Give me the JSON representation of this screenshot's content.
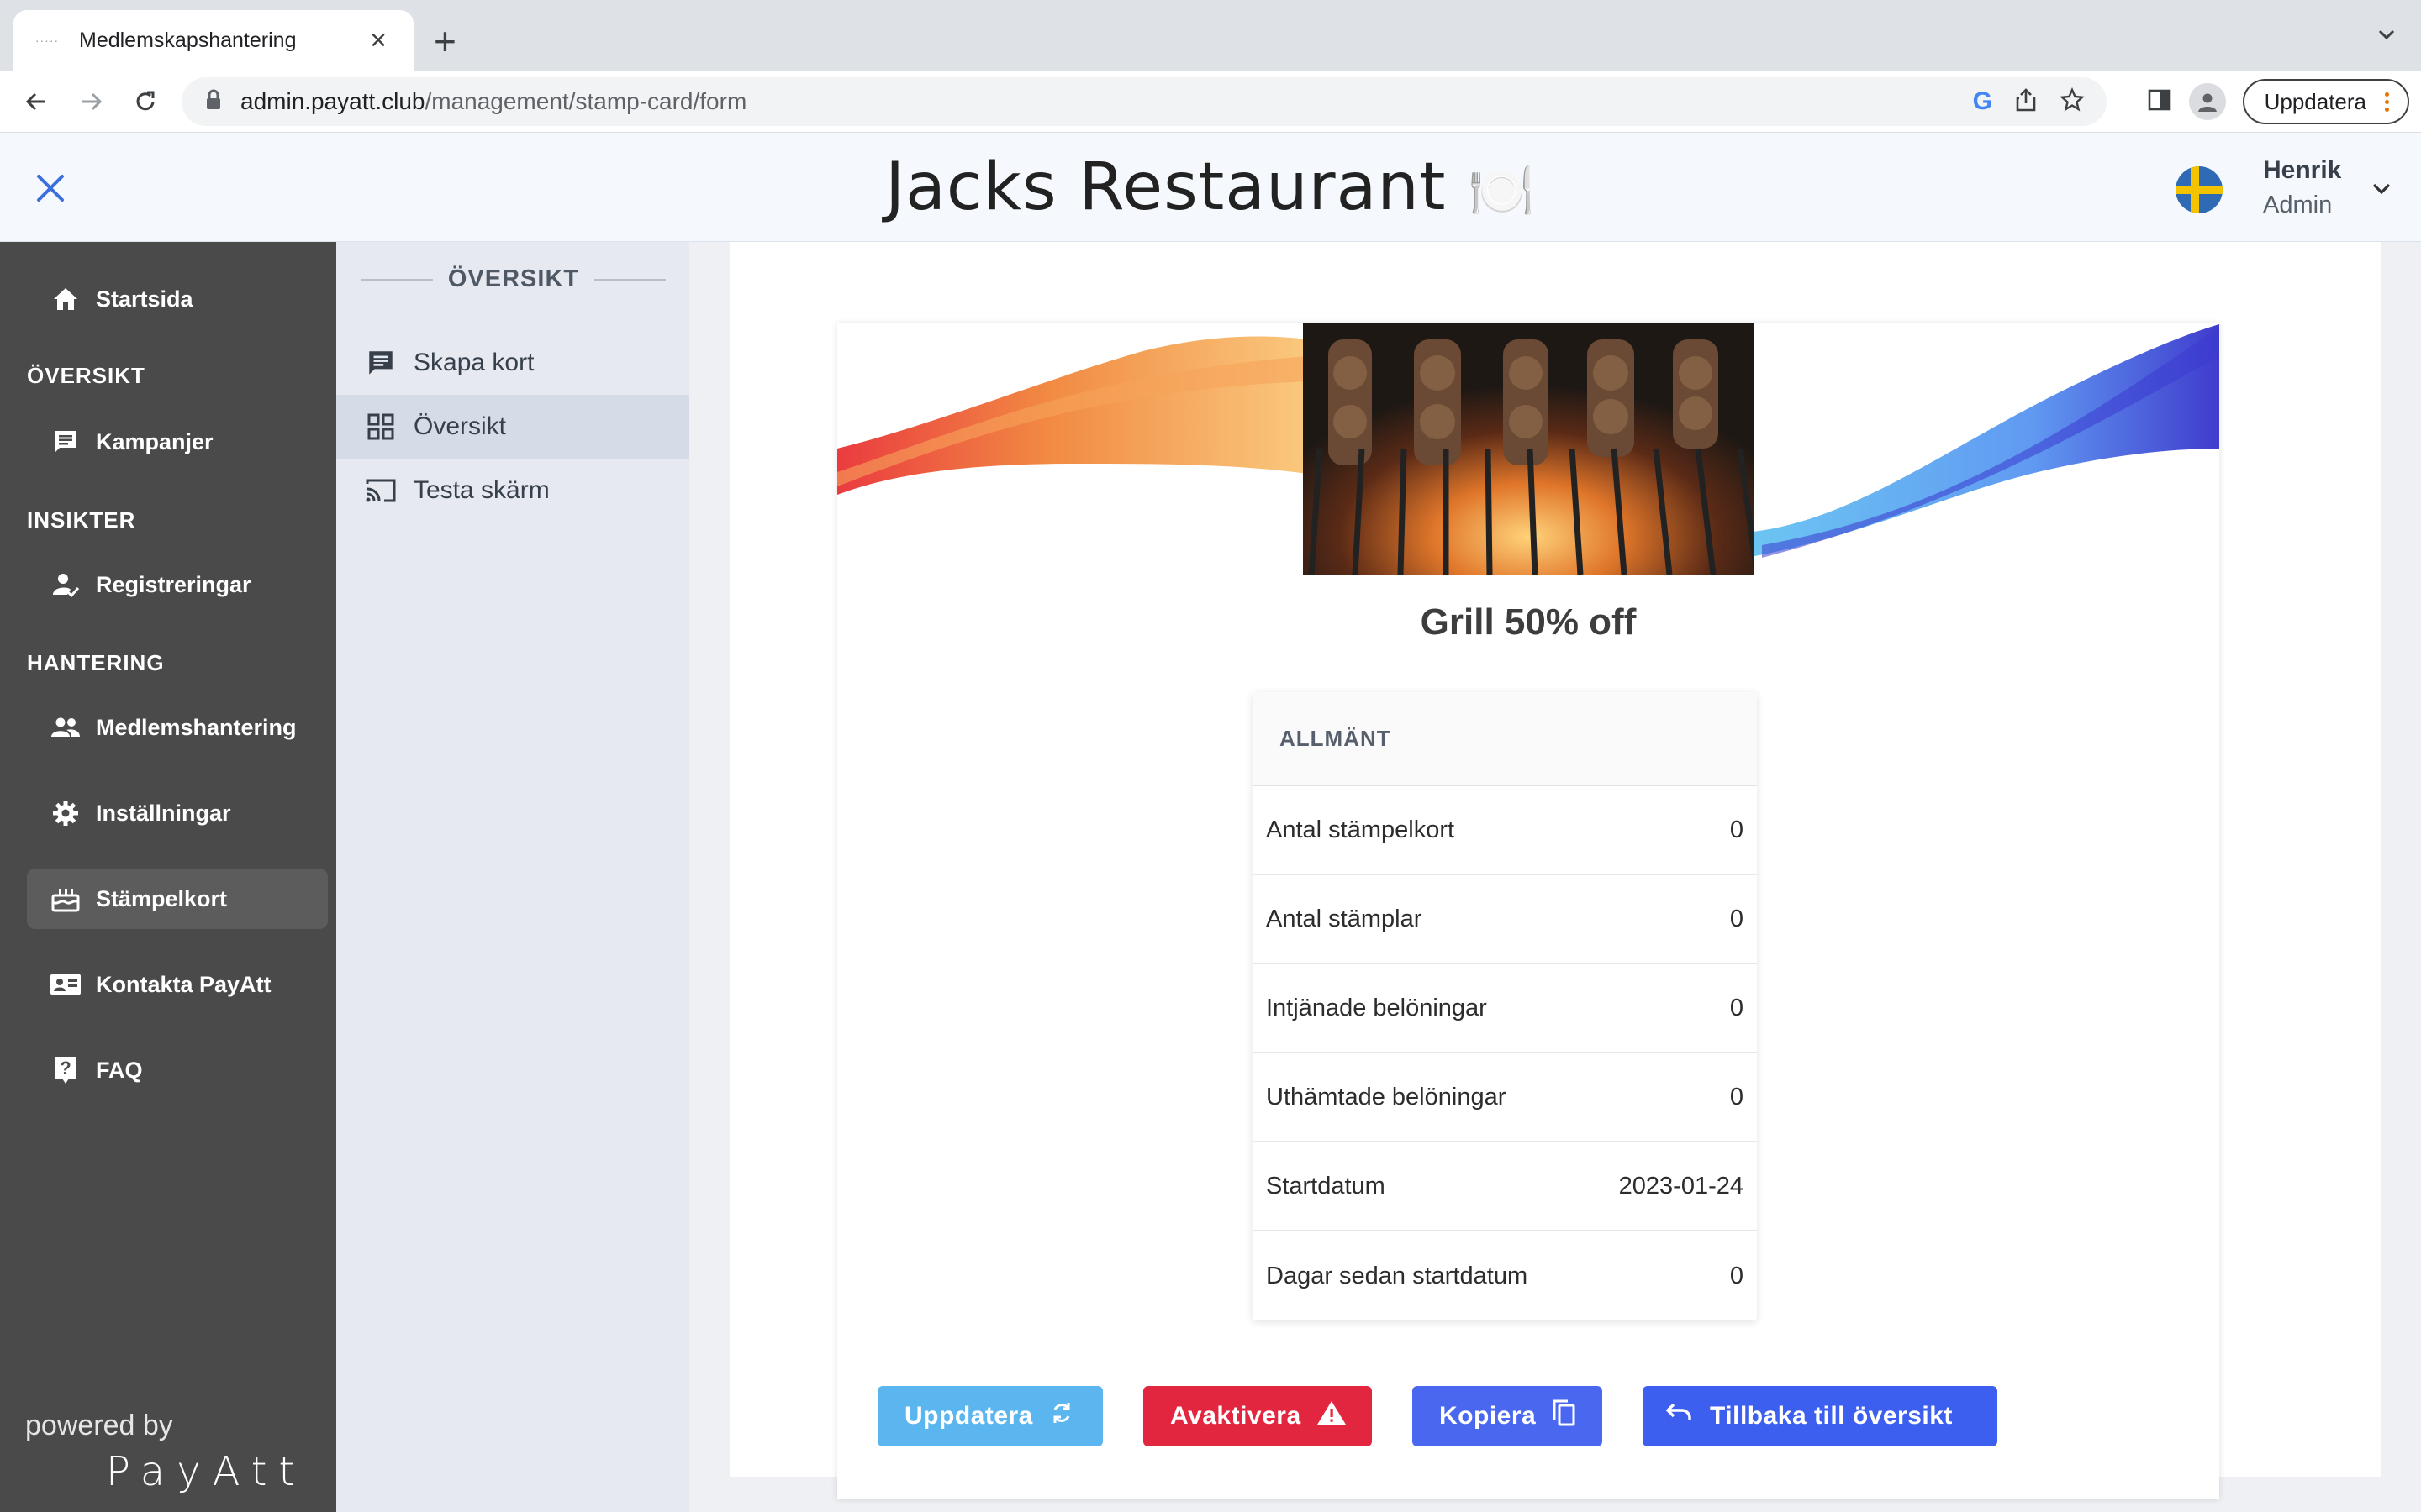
{
  "browser": {
    "tab_title": "Medlemskapshantering",
    "url_host": "admin.payatt.club",
    "url_path": "/management/stamp-card/form",
    "update_label": "Uppdatera"
  },
  "header": {
    "title": "Jacks Restaurant",
    "title_emoji": "🍽️",
    "user_name": "Henrik",
    "user_role": "Admin"
  },
  "sidebar": {
    "items": [
      {
        "label": "Startsida",
        "icon": "home-icon"
      },
      {
        "section": "ÖVERSIKT"
      },
      {
        "label": "Kampanjer",
        "icon": "message-icon"
      },
      {
        "section": "INSIKTER"
      },
      {
        "label": "Registreringar",
        "icon": "person-check-icon"
      },
      {
        "section": "HANTERING"
      },
      {
        "label": "Medlemshantering",
        "icon": "group-icon"
      },
      {
        "label": "Inställningar",
        "icon": "gear-icon"
      },
      {
        "label": "Stämpelkort",
        "icon": "cake-icon",
        "active": true
      },
      {
        "label": "Kontakta PayAtt",
        "icon": "contact-card-icon"
      },
      {
        "label": "FAQ",
        "icon": "help-icon"
      }
    ],
    "powered_by": "powered by",
    "brand": "PayAtt"
  },
  "subnav": {
    "heading": "ÖVERSIKT",
    "items": [
      {
        "label": "Skapa kort",
        "icon": "message-icon"
      },
      {
        "label": "Översikt",
        "icon": "grid-icon",
        "active": true
      },
      {
        "label": "Testa skärm",
        "icon": "cast-icon"
      }
    ]
  },
  "card": {
    "title": "Grill 50% off",
    "stats_heading": "ALLMÄNT",
    "stats": [
      {
        "label": "Antal stämpelkort",
        "value": "0"
      },
      {
        "label": "Antal stämplar",
        "value": "0"
      },
      {
        "label": "Intjänade belöningar",
        "value": "0"
      },
      {
        "label": "Uthämtade belöningar",
        "value": "0"
      },
      {
        "label": "Startdatum",
        "value": "2023-01-24"
      },
      {
        "label": "Dagar sedan startdatum",
        "value": "0"
      }
    ]
  },
  "actions": {
    "update": "Uppdatera",
    "deactivate": "Avaktivera",
    "copy": "Kopiera",
    "back": "Tillbaka till översikt"
  },
  "colors": {
    "sidebar_bg": "#4a4a4a",
    "update_btn": "#5bb6ef",
    "deactivate_btn": "#e3263f",
    "copy_btn": "#4a67f0",
    "back_btn": "#3c5ff0",
    "accent_close": "#3b6fe0"
  }
}
